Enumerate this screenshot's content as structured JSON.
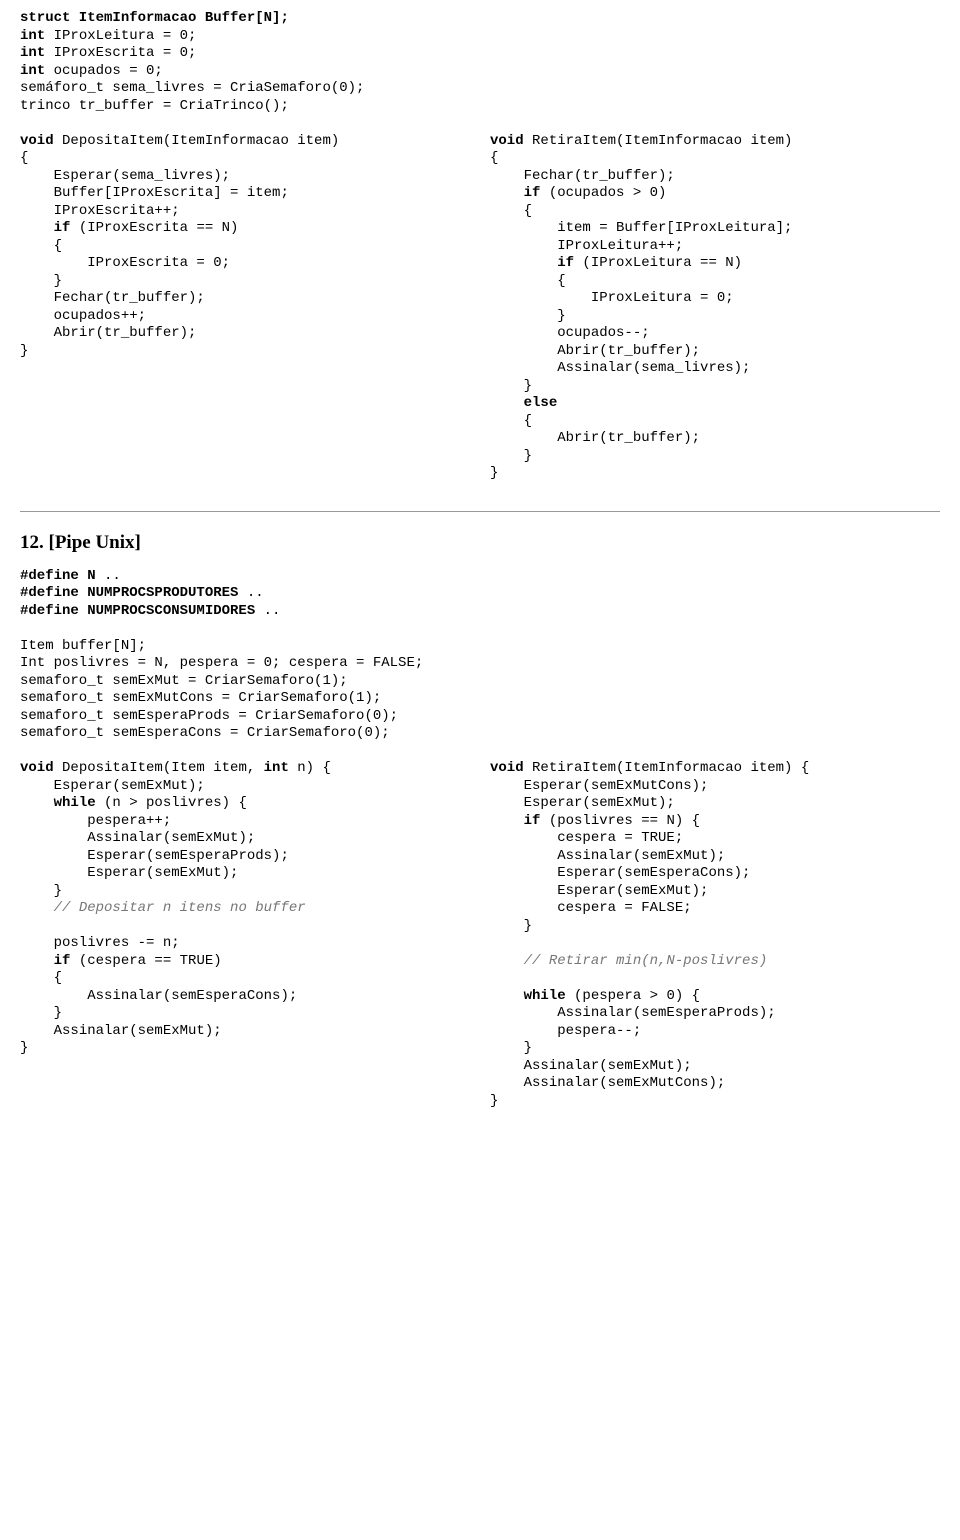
{
  "block1": {
    "globals": [
      {
        "t": "struct ItemInformacao Buffer[N];",
        "b": true
      },
      {
        "t": "int IProxLeitura = 0;",
        "b": true,
        "pre": "int"
      },
      {
        "t": "int IProxEscrita = 0;",
        "b": true,
        "pre": "int"
      },
      {
        "t": "int ocupados = 0;",
        "b": true,
        "pre": "int"
      },
      {
        "t": "semáforo_t sema_livres = CriaSemaforo(0);",
        "b": false
      },
      {
        "t": "trinco tr_buffer = CriaTrinco();",
        "b": false
      },
      {
        "t": "",
        "b": false
      }
    ],
    "left": [
      {
        "pre": "",
        "bold": "void",
        "rest": " DepositaItem(ItemInformacao item)"
      },
      {
        "pre": "",
        "bold": "",
        "rest": "{"
      },
      {
        "pre": "    ",
        "bold": "",
        "rest": "Esperar(sema_livres);"
      },
      {
        "pre": "    ",
        "bold": "",
        "rest": "Buffer[IProxEscrita] = item;"
      },
      {
        "pre": "    ",
        "bold": "",
        "rest": "IProxEscrita++;"
      },
      {
        "pre": "    ",
        "bold": "if",
        "rest": " (IProxEscrita == N)"
      },
      {
        "pre": "    ",
        "bold": "",
        "rest": "{"
      },
      {
        "pre": "        ",
        "bold": "",
        "rest": "IProxEscrita = 0;"
      },
      {
        "pre": "    ",
        "bold": "",
        "rest": "}"
      },
      {
        "pre": "    ",
        "bold": "",
        "rest": "Fechar(tr_buffer);"
      },
      {
        "pre": "    ",
        "bold": "",
        "rest": "ocupados++;"
      },
      {
        "pre": "    ",
        "bold": "",
        "rest": "Abrir(tr_buffer);"
      },
      {
        "pre": "",
        "bold": "",
        "rest": "}"
      }
    ],
    "right": [
      {
        "pre": "",
        "bold": "void",
        "rest": " RetiraItem(ItemInformacao item)"
      },
      {
        "pre": "",
        "bold": "",
        "rest": "{"
      },
      {
        "pre": "    ",
        "bold": "",
        "rest": "Fechar(tr_buffer);"
      },
      {
        "pre": "    ",
        "bold": "if",
        "rest": " (ocupados > 0)"
      },
      {
        "pre": "    ",
        "bold": "",
        "rest": "{"
      },
      {
        "pre": "        ",
        "bold": "",
        "rest": "item = Buffer[IProxLeitura];"
      },
      {
        "pre": "        ",
        "bold": "",
        "rest": "IProxLeitura++;"
      },
      {
        "pre": "        ",
        "bold": "if",
        "rest": " (IProxLeitura == N)"
      },
      {
        "pre": "        ",
        "bold": "",
        "rest": "{"
      },
      {
        "pre": "            ",
        "bold": "",
        "rest": "IProxLeitura = 0;"
      },
      {
        "pre": "        ",
        "bold": "",
        "rest": "}"
      },
      {
        "pre": "        ",
        "bold": "",
        "rest": "ocupados--;"
      },
      {
        "pre": "        ",
        "bold": "",
        "rest": "Abrir(tr_buffer);"
      },
      {
        "pre": "        ",
        "bold": "",
        "rest": "Assinalar(sema_livres);"
      },
      {
        "pre": "    ",
        "bold": "",
        "rest": "}"
      },
      {
        "pre": "    ",
        "bold": "else",
        "rest": ""
      },
      {
        "pre": "    ",
        "bold": "",
        "rest": "{"
      },
      {
        "pre": "        ",
        "bold": "",
        "rest": "Abrir(tr_buffer);"
      },
      {
        "pre": "    ",
        "bold": "",
        "rest": "}"
      },
      {
        "pre": "",
        "bold": "",
        "rest": "}"
      }
    ]
  },
  "section2_title": "12. [Pipe Unix]",
  "block2": {
    "defines": [
      {
        "bold": "#define N",
        "rest": " .."
      },
      {
        "bold": "#define NUMPROCSPRODUTORES",
        "rest": " .."
      },
      {
        "bold": "#define NUMPROCSCONSUMIDORES",
        "rest": " .."
      }
    ],
    "globals": [
      "Item buffer[N];",
      "Int poslivres = N, pespera = 0; cespera = FALSE;",
      "semaforo_t semExMut = CriarSemaforo(1);",
      "semaforo_t semExMutCons = CriarSemaforo(1);",
      "semaforo_t semEsperaProds = CriarSemaforo(0);",
      "semaforo_t semEsperaCons = CriarSemaforo(0);"
    ],
    "left": [
      {
        "pre": "",
        "spans": [
          {
            "b": true,
            "t": "void"
          },
          {
            "b": false,
            "t": " DepositaItem(Item item, "
          },
          {
            "b": true,
            "t": "int"
          },
          {
            "b": false,
            "t": " n) {"
          }
        ]
      },
      {
        "pre": "    ",
        "spans": [
          {
            "b": false,
            "t": "Esperar(semExMut);"
          }
        ]
      },
      {
        "pre": "    ",
        "spans": [
          {
            "b": true,
            "t": "while"
          },
          {
            "b": false,
            "t": " (n > poslivres) {"
          }
        ]
      },
      {
        "pre": "        ",
        "spans": [
          {
            "b": false,
            "t": "pespera++;"
          }
        ]
      },
      {
        "pre": "        ",
        "spans": [
          {
            "b": false,
            "t": "Assinalar(semExMut);"
          }
        ]
      },
      {
        "pre": "        ",
        "spans": [
          {
            "b": false,
            "t": "Esperar(semEsperaProds);"
          }
        ]
      },
      {
        "pre": "        ",
        "spans": [
          {
            "b": false,
            "t": "Esperar(semExMut);"
          }
        ]
      },
      {
        "pre": "    ",
        "spans": [
          {
            "b": false,
            "t": "}"
          }
        ]
      },
      {
        "pre": "    ",
        "spans": [
          {
            "c": true,
            "t": "// Depositar n itens no buffer"
          }
        ]
      },
      {
        "pre": "",
        "spans": [
          {
            "b": false,
            "t": ""
          }
        ]
      },
      {
        "pre": "    ",
        "spans": [
          {
            "b": false,
            "t": "poslivres -= n;"
          }
        ]
      },
      {
        "pre": "    ",
        "spans": [
          {
            "b": true,
            "t": "if"
          },
          {
            "b": false,
            "t": " (cespera == TRUE)"
          }
        ]
      },
      {
        "pre": "    ",
        "spans": [
          {
            "b": false,
            "t": "{"
          }
        ]
      },
      {
        "pre": "        ",
        "spans": [
          {
            "b": false,
            "t": "Assinalar(semEsperaCons);"
          }
        ]
      },
      {
        "pre": "    ",
        "spans": [
          {
            "b": false,
            "t": "}"
          }
        ]
      },
      {
        "pre": "    ",
        "spans": [
          {
            "b": false,
            "t": "Assinalar(semExMut);"
          }
        ]
      },
      {
        "pre": "",
        "spans": [
          {
            "b": false,
            "t": "}"
          }
        ]
      }
    ],
    "right": [
      {
        "pre": "",
        "spans": [
          {
            "b": true,
            "t": "void"
          },
          {
            "b": false,
            "t": " RetiraItem(ItemInformacao item) {"
          }
        ]
      },
      {
        "pre": "    ",
        "spans": [
          {
            "b": false,
            "t": "Esperar(semExMutCons);"
          }
        ]
      },
      {
        "pre": "    ",
        "spans": [
          {
            "b": false,
            "t": "Esperar(semExMut);"
          }
        ]
      },
      {
        "pre": "    ",
        "spans": [
          {
            "b": true,
            "t": "if"
          },
          {
            "b": false,
            "t": " (poslivres == N) {"
          }
        ]
      },
      {
        "pre": "        ",
        "spans": [
          {
            "b": false,
            "t": "cespera = TRUE;"
          }
        ]
      },
      {
        "pre": "        ",
        "spans": [
          {
            "b": false,
            "t": "Assinalar(semExMut);"
          }
        ]
      },
      {
        "pre": "        ",
        "spans": [
          {
            "b": false,
            "t": "Esperar(semEsperaCons);"
          }
        ]
      },
      {
        "pre": "        ",
        "spans": [
          {
            "b": false,
            "t": "Esperar(semExMut);"
          }
        ]
      },
      {
        "pre": "        ",
        "spans": [
          {
            "b": false,
            "t": "cespera = FALSE;"
          }
        ]
      },
      {
        "pre": "    ",
        "spans": [
          {
            "b": false,
            "t": "}"
          }
        ]
      },
      {
        "pre": "",
        "spans": [
          {
            "b": false,
            "t": ""
          }
        ]
      },
      {
        "pre": "    ",
        "spans": [
          {
            "c": true,
            "t": "// Retirar min(n,N-poslivres)"
          }
        ]
      },
      {
        "pre": "",
        "spans": [
          {
            "b": false,
            "t": ""
          }
        ]
      },
      {
        "pre": "    ",
        "spans": [
          {
            "b": true,
            "t": "while"
          },
          {
            "b": false,
            "t": " (pespera > 0) {"
          }
        ]
      },
      {
        "pre": "        ",
        "spans": [
          {
            "b": false,
            "t": "Assinalar(semEsperaProds);"
          }
        ]
      },
      {
        "pre": "        ",
        "spans": [
          {
            "b": false,
            "t": "pespera--;"
          }
        ]
      },
      {
        "pre": "    ",
        "spans": [
          {
            "b": false,
            "t": "}"
          }
        ]
      },
      {
        "pre": "    ",
        "spans": [
          {
            "b": false,
            "t": "Assinalar(semExMut);"
          }
        ]
      },
      {
        "pre": "    ",
        "spans": [
          {
            "b": false,
            "t": "Assinalar(semExMutCons);"
          }
        ]
      },
      {
        "pre": "",
        "spans": [
          {
            "b": false,
            "t": "}"
          }
        ]
      }
    ]
  }
}
